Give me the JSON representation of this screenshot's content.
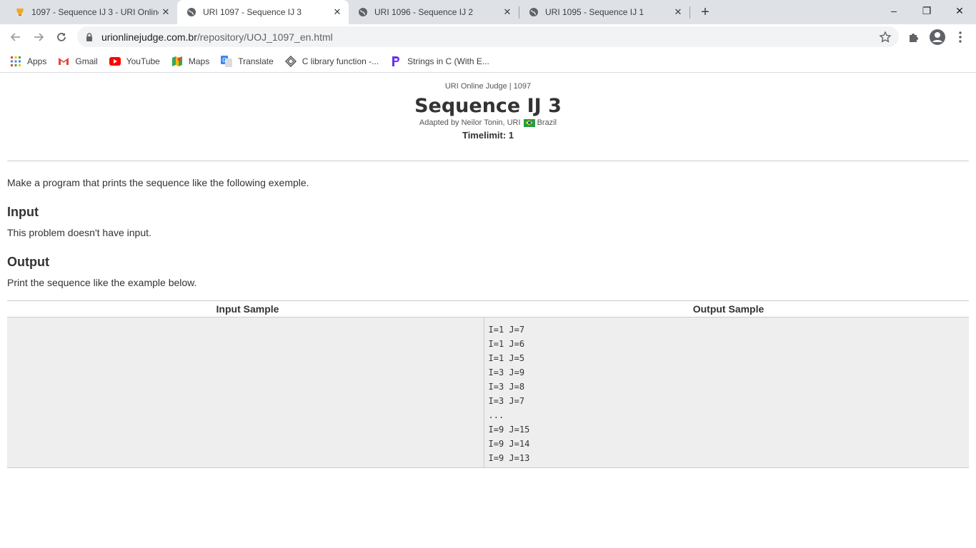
{
  "browser": {
    "tabs": [
      {
        "title": "1097 - Sequence IJ 3 - URI Online Judge",
        "icon": "uri-trophy-icon",
        "active": false
      },
      {
        "title": "URI 1097 - Sequence IJ 3",
        "icon": "globe-icon",
        "active": true
      },
      {
        "title": "URI 1096 - Sequence IJ 2",
        "icon": "globe-icon",
        "active": false
      },
      {
        "title": "URI 1095 - Sequence IJ 1",
        "icon": "globe-icon",
        "active": false
      }
    ],
    "new_tab_symbol": "+",
    "window_controls": {
      "minimize": "–",
      "restore": "❐",
      "close": "✕"
    },
    "url_domain": "urionlinejudge.com.br",
    "url_path": "/repository/UOJ_1097_en.html",
    "bookmarks": [
      {
        "label": "Apps",
        "icon": "apps-grid-icon"
      },
      {
        "label": "Gmail",
        "icon": "gmail-icon"
      },
      {
        "label": "YouTube",
        "icon": "youtube-icon"
      },
      {
        "label": "Maps",
        "icon": "maps-icon"
      },
      {
        "label": "Translate",
        "icon": "translate-icon"
      },
      {
        "label": "C library function -...",
        "icon": "c-library-icon"
      },
      {
        "label": "Strings in C (With E...",
        "icon": "programiz-icon"
      }
    ]
  },
  "problem": {
    "source": "URI Online Judge | 1097",
    "title": "Sequence IJ 3",
    "adapted_prefix": "Adapted by Neilor Tonin, URI",
    "country": "Brazil",
    "timelimit": "Timelimit: 1",
    "description": "Make a program that prints the sequence like the following exemple.",
    "input_heading": "Input",
    "input_text": "This problem doesn't have input.",
    "output_heading": "Output",
    "output_text": "Print the sequence like the example below."
  },
  "samples": {
    "input_header": "Input Sample",
    "output_header": "Output Sample",
    "output_lines": [
      "I=1 J=7",
      "I=1 J=6",
      "I=1 J=5",
      "I=3 J=9",
      "I=3 J=8",
      "I=3 J=7",
      "...",
      "I=9 J=15",
      "I=9 J=14",
      "I=9 J=13"
    ]
  },
  "colors": {
    "tabstrip_bg": "#dee1e6",
    "sample_bg": "#eeeeee",
    "text": "#333333"
  }
}
